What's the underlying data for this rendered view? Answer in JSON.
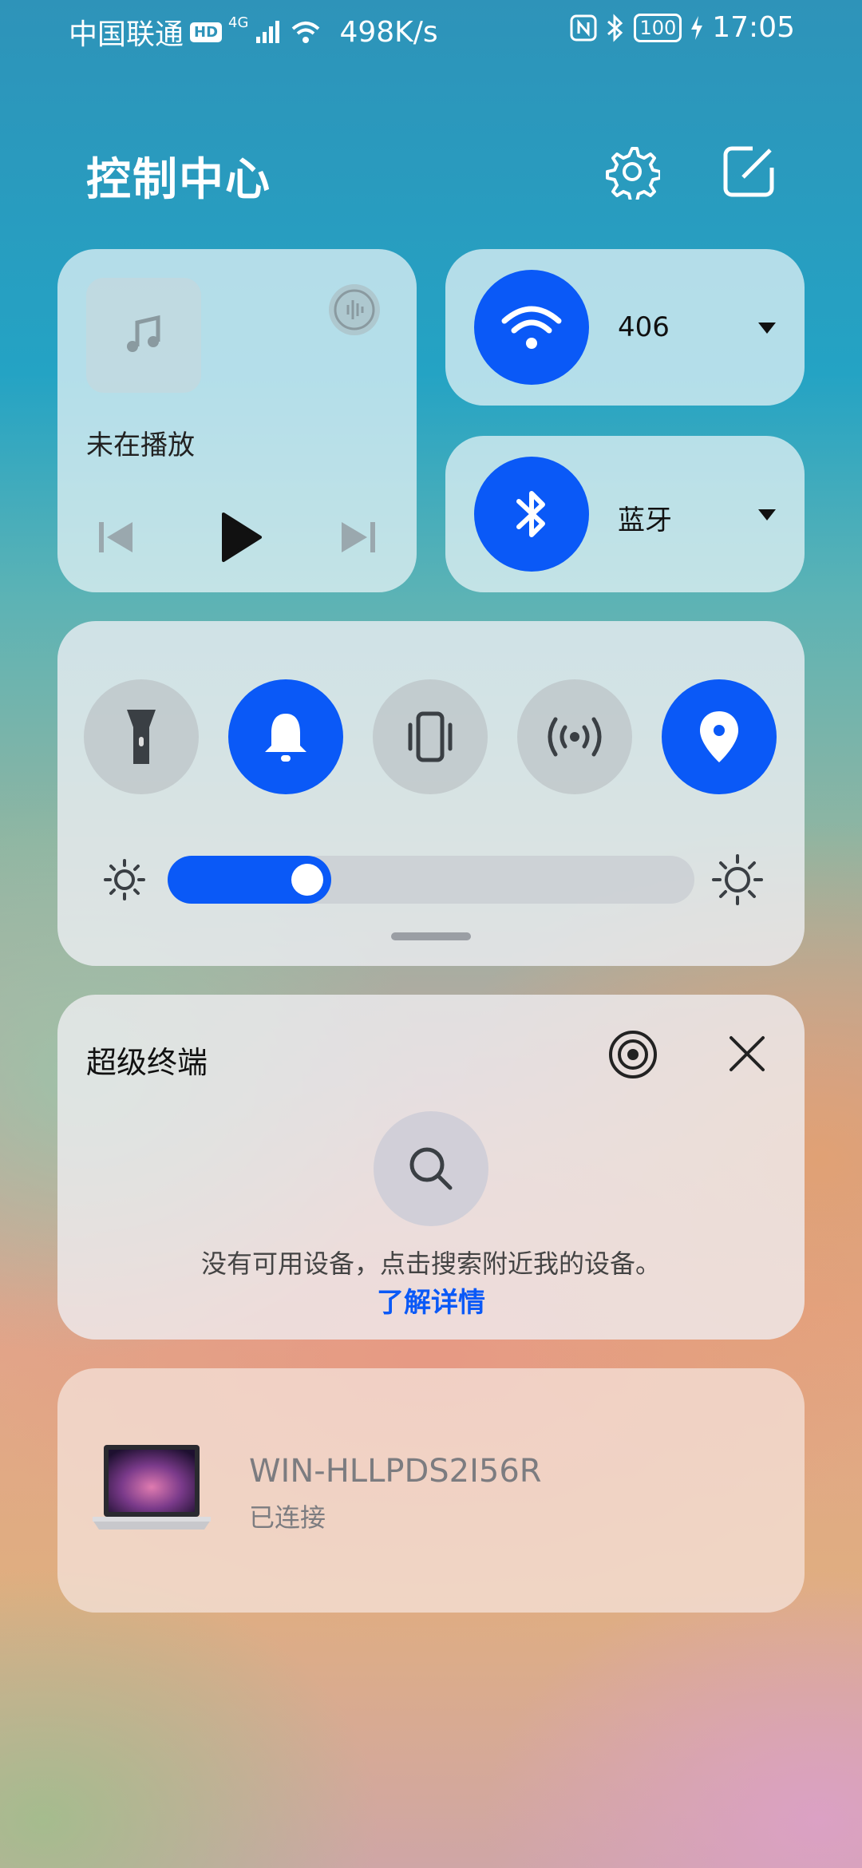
{
  "status_bar": {
    "carrier": "中国联通",
    "hd": "HD",
    "network": "4G",
    "speed": "498K/s",
    "battery": "100",
    "time": "17:05"
  },
  "header": {
    "title": "控制中心"
  },
  "media": {
    "status": "未在播放"
  },
  "wifi": {
    "label": "406",
    "on": true
  },
  "bluetooth": {
    "label": "蓝牙",
    "on": true
  },
  "toggles": [
    {
      "name": "flashlight",
      "on": false
    },
    {
      "name": "sound",
      "on": true
    },
    {
      "name": "vibrate",
      "on": false
    },
    {
      "name": "hotspot",
      "on": false
    },
    {
      "name": "location",
      "on": true
    }
  ],
  "brightness": {
    "level": 0.31
  },
  "super_device": {
    "title": "超级终端",
    "empty_text": "没有可用设备，点击搜索附近我的设备。",
    "learn_more": "了解详情"
  },
  "connected_device": {
    "name": "WIN-HLLPDS2I56R",
    "status": "已连接"
  },
  "colors": {
    "accent": "#0a59f7",
    "link": "#0a59f7"
  }
}
